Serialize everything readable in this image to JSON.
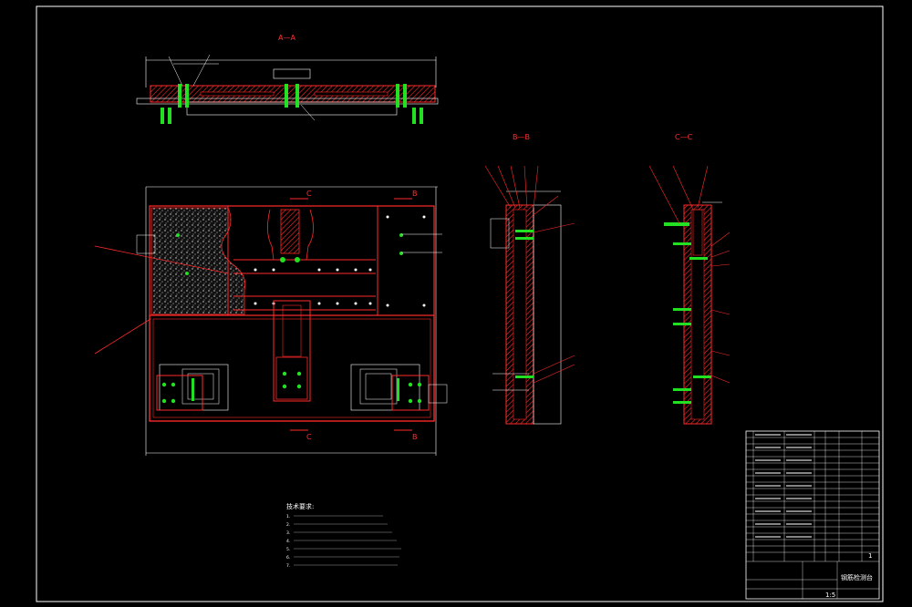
{
  "drawing": {
    "section_labels": {
      "aa": "A—A",
      "bb": "B—B",
      "cc": "C—C",
      "b_cut": "B",
      "c_cut": "C"
    },
    "tech_notes": {
      "title": "技术要求:",
      "lines": [
        "1.",
        "2.",
        "3.",
        "4.",
        "5.",
        "6.",
        "7."
      ]
    },
    "title_block": {
      "drawing_name": "钢筋检测台",
      "scale": "1:5",
      "sheet": "1"
    },
    "colors": {
      "background": "#000000",
      "frame": "#ffffff",
      "section": "#ff2a2a",
      "bolt": "#22e022",
      "hatch": "#d0d0d0"
    }
  }
}
